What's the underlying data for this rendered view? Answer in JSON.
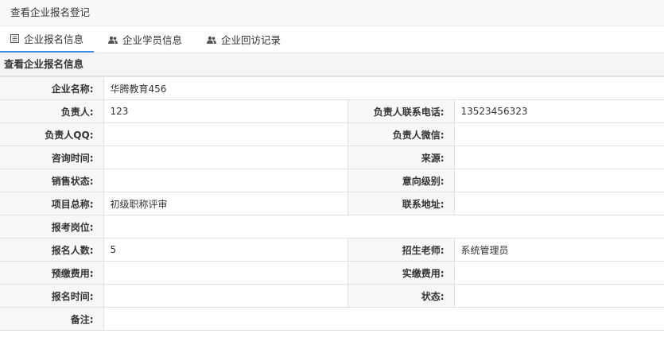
{
  "page_title": "查看企业报名登记",
  "tabs": [
    {
      "label": "企业报名信息",
      "icon": "list-icon",
      "active": true
    },
    {
      "label": "企业学员信息",
      "icon": "users-icon",
      "active": false
    },
    {
      "label": "企业回访记录",
      "icon": "users-icon",
      "active": false
    }
  ],
  "section_title": "查看企业报名信息",
  "fields": {
    "company_name": {
      "label": "企业名称:",
      "value": "华腾教育456"
    },
    "person_in_charge": {
      "label": "负责人:",
      "value": "123"
    },
    "contact_phone": {
      "label": "负责人联系电话:",
      "value": "13523456323"
    },
    "qq": {
      "label": "负责人QQ:",
      "value": ""
    },
    "wechat": {
      "label": "负责人微信:",
      "value": ""
    },
    "consult_time": {
      "label": "咨询时间:",
      "value": ""
    },
    "source": {
      "label": "来源:",
      "value": ""
    },
    "sales_status": {
      "label": "销售状态:",
      "value": ""
    },
    "intent_level": {
      "label": "意向级别:",
      "value": ""
    },
    "project_name": {
      "label": "项目总称:",
      "value": "初级职称评审"
    },
    "address": {
      "label": "联系地址:",
      "value": ""
    },
    "exam_position": {
      "label": "报考岗位:",
      "value": ""
    },
    "enroll_count": {
      "label": "报名人数:",
      "value": "5"
    },
    "teacher": {
      "label": "招生老师:",
      "value": "系统管理员"
    },
    "prepaid_fee": {
      "label": "预缴费用:",
      "value": ""
    },
    "paid_fee": {
      "label": "实缴费用:",
      "value": ""
    },
    "enroll_time": {
      "label": "报名时间:",
      "value": ""
    },
    "status": {
      "label": "状态:",
      "value": ""
    },
    "remark": {
      "label": "备注:",
      "value": ""
    }
  }
}
